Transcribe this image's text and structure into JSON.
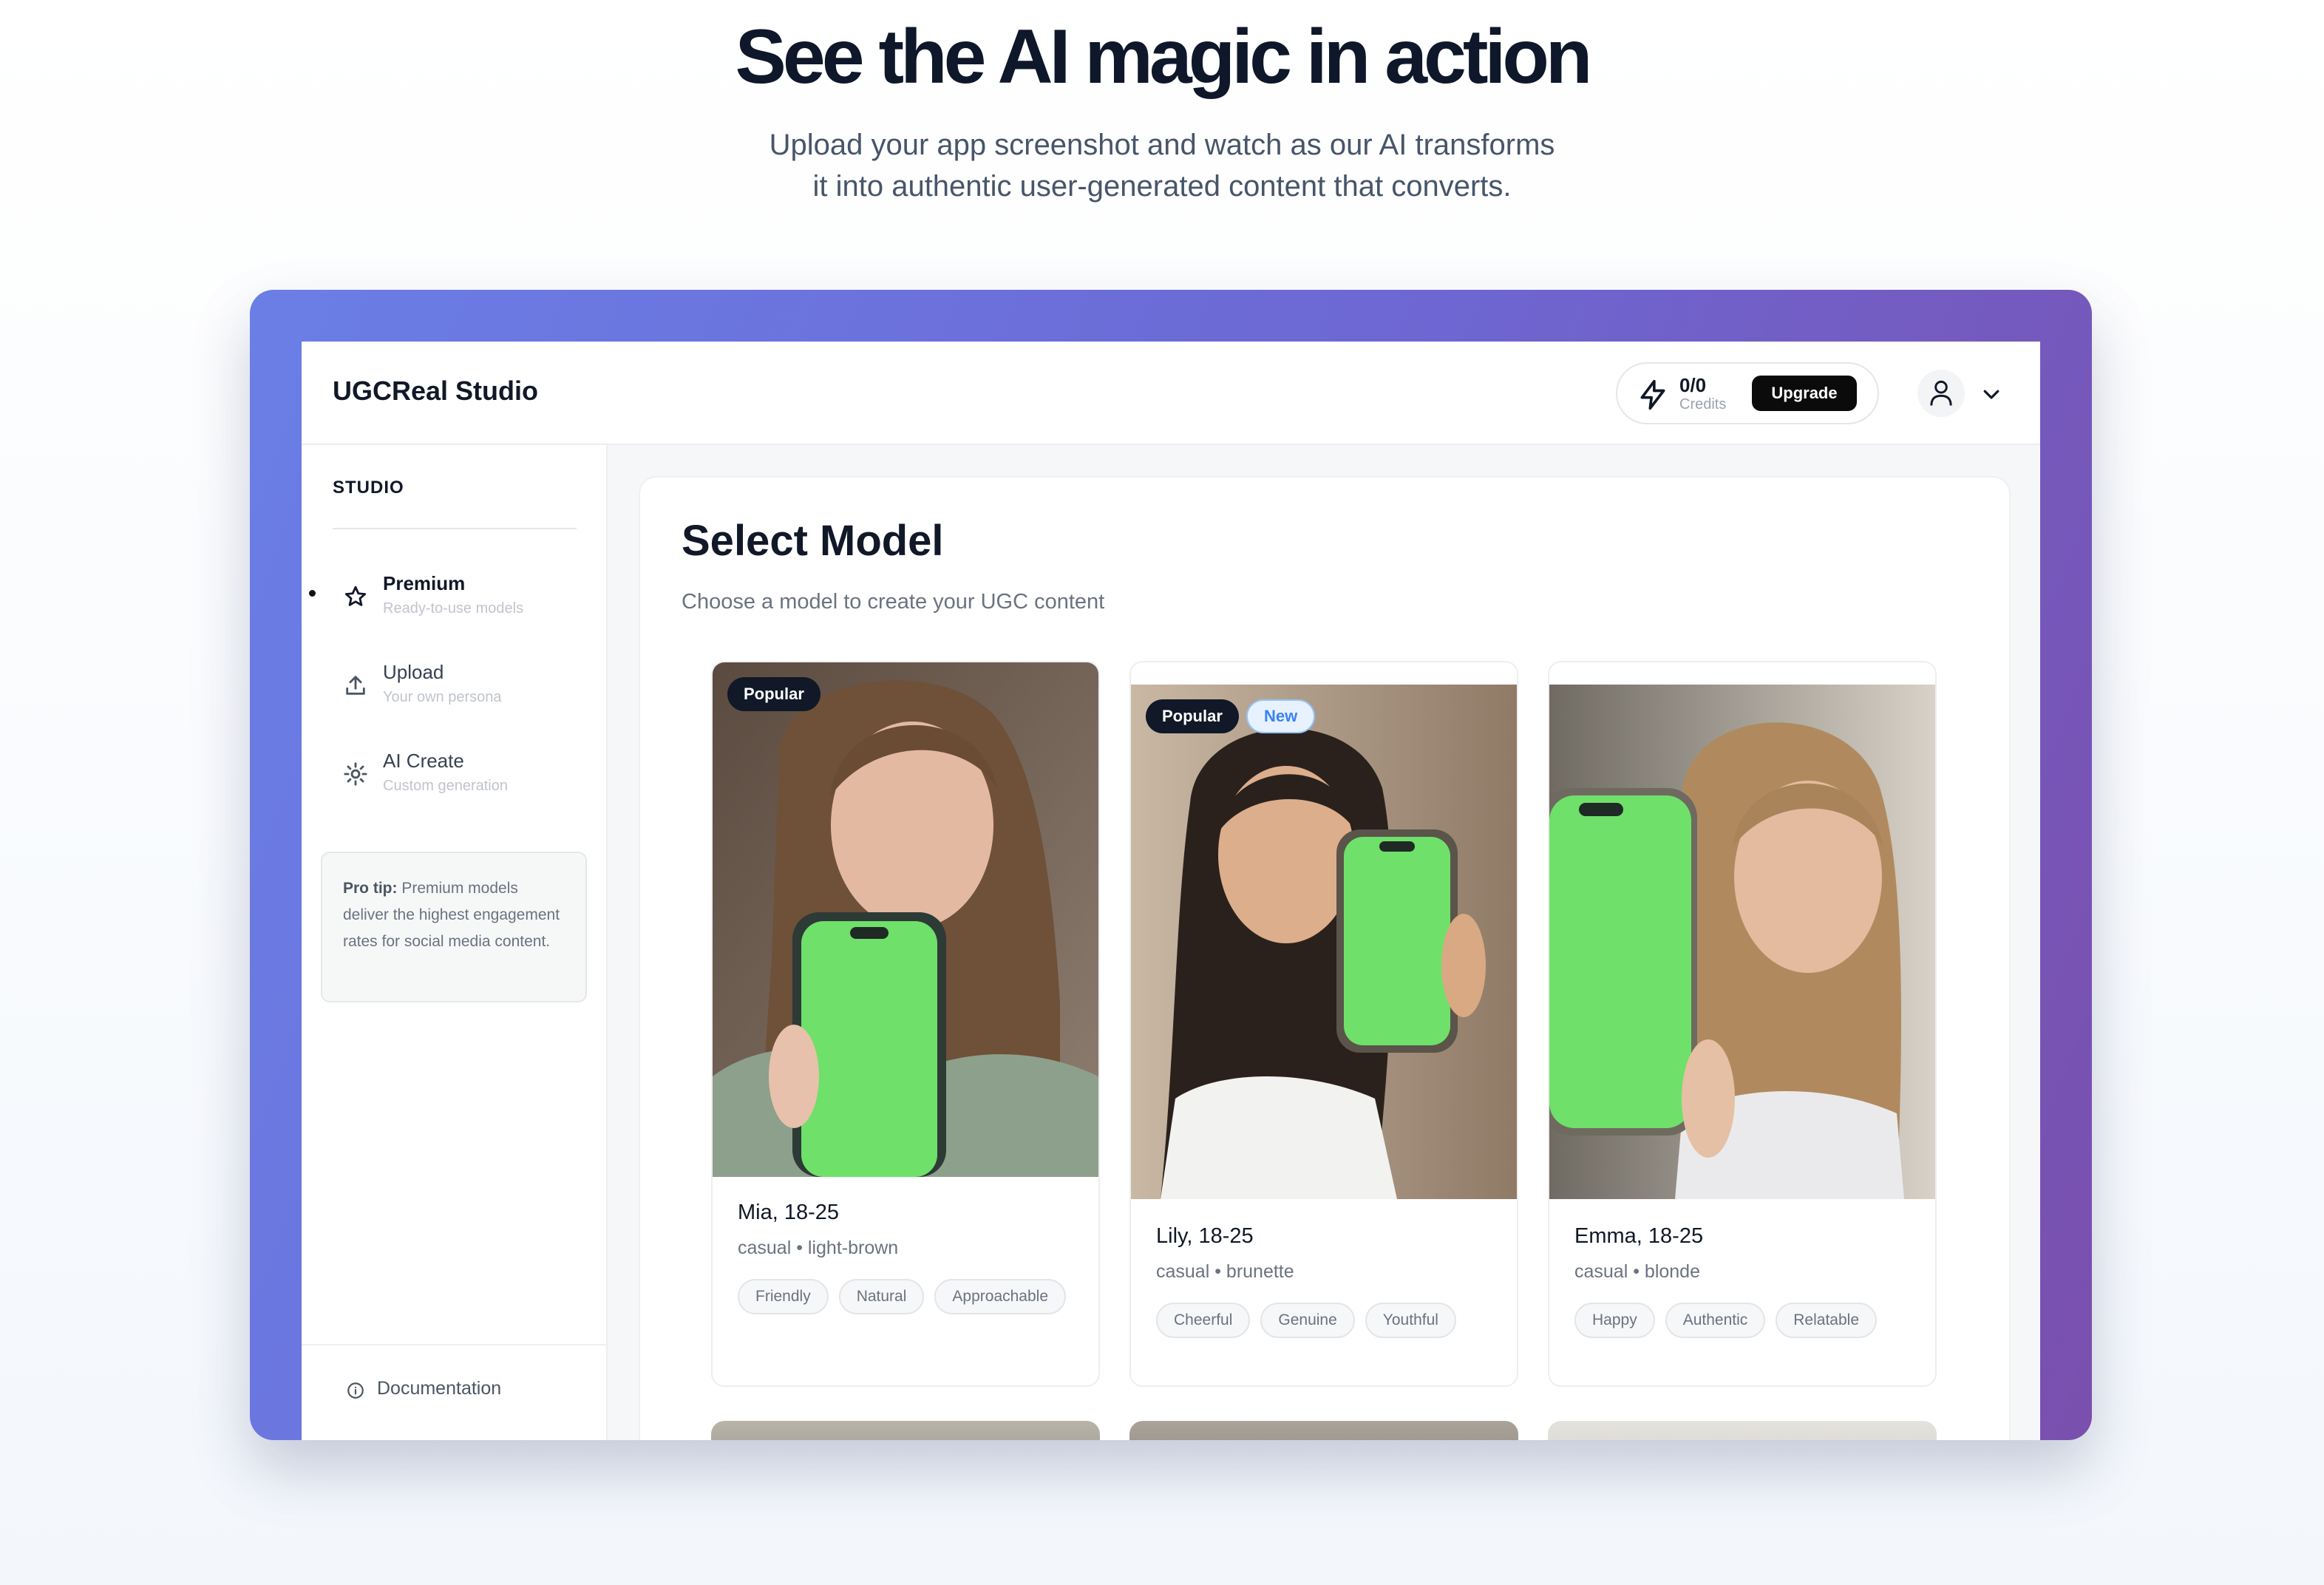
{
  "hero": {
    "title": "See the AI magic in action",
    "subtitle_line1": "Upload your app screenshot and watch as our AI transforms",
    "subtitle_line2": "it into authentic user-generated content that converts."
  },
  "app": {
    "brand": "UGCReal Studio",
    "credits": {
      "value": "0/0",
      "label": "Credits",
      "upgrade_label": "Upgrade"
    }
  },
  "sidebar": {
    "section_label": "STUDIO",
    "items": [
      {
        "title": "Premium",
        "desc": "Ready-to-use models",
        "icon": "star-icon",
        "active": true
      },
      {
        "title": "Upload",
        "desc": "Your own persona",
        "icon": "upload-icon",
        "active": false
      },
      {
        "title": "AI Create",
        "desc": "Custom generation",
        "icon": "sparkle-icon",
        "active": false
      }
    ],
    "tip": {
      "head": "Pro tip:",
      "body": " Premium models deliver the highest engagement rates for social media content."
    },
    "footer_link": "Documentation"
  },
  "main": {
    "title": "Select Model",
    "subtitle": "Choose a model to create your UGC content",
    "models": [
      {
        "name": "Mia, 18-25",
        "meta": "casual • light-brown",
        "badges": [
          "Popular"
        ],
        "tags": [
          "Friendly",
          "Natural",
          "Approachable"
        ]
      },
      {
        "name": "Lily, 18-25",
        "meta": "casual • brunette",
        "badges": [
          "Popular",
          "New"
        ],
        "tags": [
          "Cheerful",
          "Genuine",
          "Youthful"
        ]
      },
      {
        "name": "Emma, 18-25",
        "meta": "casual • blonde",
        "badges": [],
        "tags": [
          "Happy",
          "Authentic",
          "Relatable"
        ]
      }
    ]
  },
  "colors": {
    "frame_start": "#6a7fe6",
    "frame_end": "#7a4fae",
    "accent_green": "#6fe06a",
    "new_badge": "#3b82f6"
  }
}
